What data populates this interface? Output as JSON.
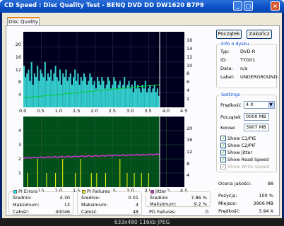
{
  "window": {
    "title": "CD Speed : Disc Quality Test - BENQ   DVD DD DW1620   B7P9"
  },
  "tab": {
    "label": "Disc Quality"
  },
  "buttons": {
    "start": "Początek",
    "close": "Zakończ"
  },
  "top_chart": {
    "x_ticks": [
      "0.0",
      "0.5",
      "1.0",
      "1.5",
      "2.0",
      "2.5",
      "3.0",
      "3.5",
      "4.0",
      "4.5"
    ],
    "y_left": [
      "20",
      "16",
      "12",
      "8",
      "4"
    ],
    "y_right": [
      "16",
      "14",
      "12",
      "10",
      "8",
      "6",
      "4",
      "2"
    ],
    "pi_errors_profile": [
      11,
      8,
      9,
      10,
      7,
      12,
      6,
      9,
      8,
      11,
      7,
      10,
      9,
      8,
      12,
      7,
      9,
      8,
      10,
      7,
      9,
      11,
      8,
      7,
      10,
      6,
      9,
      8,
      10,
      7,
      8,
      9,
      6,
      8,
      10,
      7,
      9,
      6,
      8,
      7,
      9,
      8,
      6,
      7,
      9,
      8,
      6,
      7,
      5,
      8,
      7,
      6,
      8,
      7,
      5,
      6,
      8,
      7,
      5,
      6,
      8,
      7,
      5,
      6,
      7,
      5,
      6,
      8,
      5,
      6,
      7,
      5,
      6,
      4,
      7,
      5,
      6,
      5,
      4,
      6,
      5,
      7,
      4,
      5,
      6,
      4,
      5,
      6,
      4,
      5,
      3
    ],
    "speed_start": 2.0,
    "speed_end": 4.8,
    "end_position": 3.81
  },
  "bottom_chart": {
    "x_ticks": [
      "0.0",
      "0.5",
      "1.0",
      "1.5",
      "2.0",
      "2.5",
      "3.0",
      "3.5",
      "4.0",
      "4.5"
    ],
    "y_left": [
      "4",
      "3",
      "2",
      "1"
    ],
    "y_right": [
      "20",
      "16",
      "12",
      "8",
      "4"
    ],
    "jitter_start": 8.3,
    "jitter_end": 9.3,
    "pif_spikes": [
      [
        0.12,
        1
      ],
      [
        0.4,
        2
      ],
      [
        0.9,
        1
      ],
      [
        1.1,
        2
      ],
      [
        1.45,
        1
      ],
      [
        1.9,
        1
      ],
      [
        2.3,
        1
      ],
      [
        2.7,
        2
      ],
      [
        3.1,
        1
      ],
      [
        3.5,
        1
      ],
      [
        0.65,
        1
      ],
      [
        2.05,
        1
      ],
      [
        3.3,
        1
      ],
      [
        1.6,
        2
      ],
      [
        2.9,
        1
      ]
    ],
    "end_position": 3.81
  },
  "info": {
    "title": "Info o dysku",
    "rows": [
      {
        "label": "Typ:",
        "value": "DVD-R"
      },
      {
        "label": "ID:",
        "value": "TYG01"
      },
      {
        "label": "Data:",
        "value": "n/a"
      },
      {
        "label": "Label:",
        "value": "UNDERGROUND:"
      }
    ]
  },
  "settings": {
    "title": "Settings",
    "speed_label": "Prędkość",
    "speed_value": "4 X",
    "start_label": "Początek",
    "start_value": "0000 MB",
    "end_label": "Koniec",
    "end_value": "3907 MB",
    "checkboxes": [
      {
        "label": "Show C1/PIE",
        "checked": true
      },
      {
        "label": "Show C2/PIF",
        "checked": true
      },
      {
        "label": "Show Jitter",
        "checked": true
      },
      {
        "label": "Show Read Speed",
        "checked": true
      },
      {
        "label": "Show Write Speed",
        "checked": false
      }
    ]
  },
  "pi_errors": {
    "title": "PI Errors",
    "color": "#00ffff",
    "rows": [
      {
        "label": "Średnio:",
        "value": "4.30"
      },
      {
        "label": "Maksimum:",
        "value": "13"
      },
      {
        "label": "Całość:",
        "value": "40046"
      }
    ]
  },
  "pi_failures": {
    "title": "PI Failures",
    "color": "#ffff00",
    "rows": [
      {
        "label": "Średnio:",
        "value": "0.01"
      },
      {
        "label": "Maksimum:",
        "value": "4"
      },
      {
        "label": "Całość:",
        "value": "48"
      }
    ]
  },
  "jitter": {
    "title": "Jitter",
    "color": "#cc33cc",
    "rows": [
      {
        "label": "Średnio:",
        "value": "7.86 %"
      },
      {
        "label": "Maksimum:",
        "value": "9.2 %"
      }
    ]
  },
  "po_failures": {
    "label": "PO Failures:",
    "value": "0"
  },
  "quality": {
    "label": "Ocena jakości:",
    "value": "98"
  },
  "progress": {
    "rows": [
      {
        "label": "Pozycja:",
        "value": "100 %"
      },
      {
        "label": "Miejsce:",
        "value": "3906 MB"
      },
      {
        "label": "Prędkość:",
        "value": "3.94 X"
      }
    ]
  },
  "statusbar": {
    "text": "633x480 116kb JPEG"
  },
  "colors": {
    "chart_bg": "#00001e",
    "pie": "#33cccc",
    "speed": "#00cc33",
    "jitter": "#cc33cc",
    "pif": "#ffff00",
    "lower_bg": "#004d1a"
  }
}
